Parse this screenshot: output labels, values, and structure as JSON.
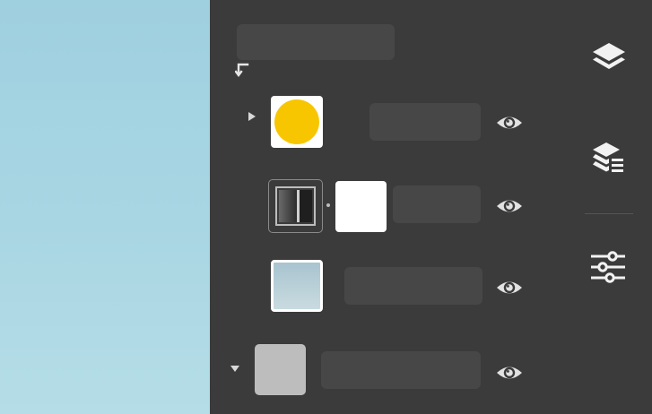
{
  "canvas": {
    "background": "#a6d4e2"
  },
  "layers_panel": {
    "name_placeholder": "",
    "rows": [
      {
        "type": "shape-layer",
        "expanded": false,
        "fill_color": "#f7c600",
        "visible": true
      },
      {
        "type": "adjustment-with-mask",
        "visible": true
      },
      {
        "type": "gradient-layer",
        "visible": true
      },
      {
        "type": "group",
        "expanded": true,
        "fill_color": "#bdbdbd",
        "visible": true
      }
    ]
  },
  "side_toolbar": {
    "icons": [
      "layers-icon",
      "layer-stack-properties-icon",
      "adjustments-sliders-icon"
    ]
  },
  "colors": {
    "panel": "#3b3b3b",
    "field": "#474747",
    "accent_yellow": "#f7c600"
  }
}
